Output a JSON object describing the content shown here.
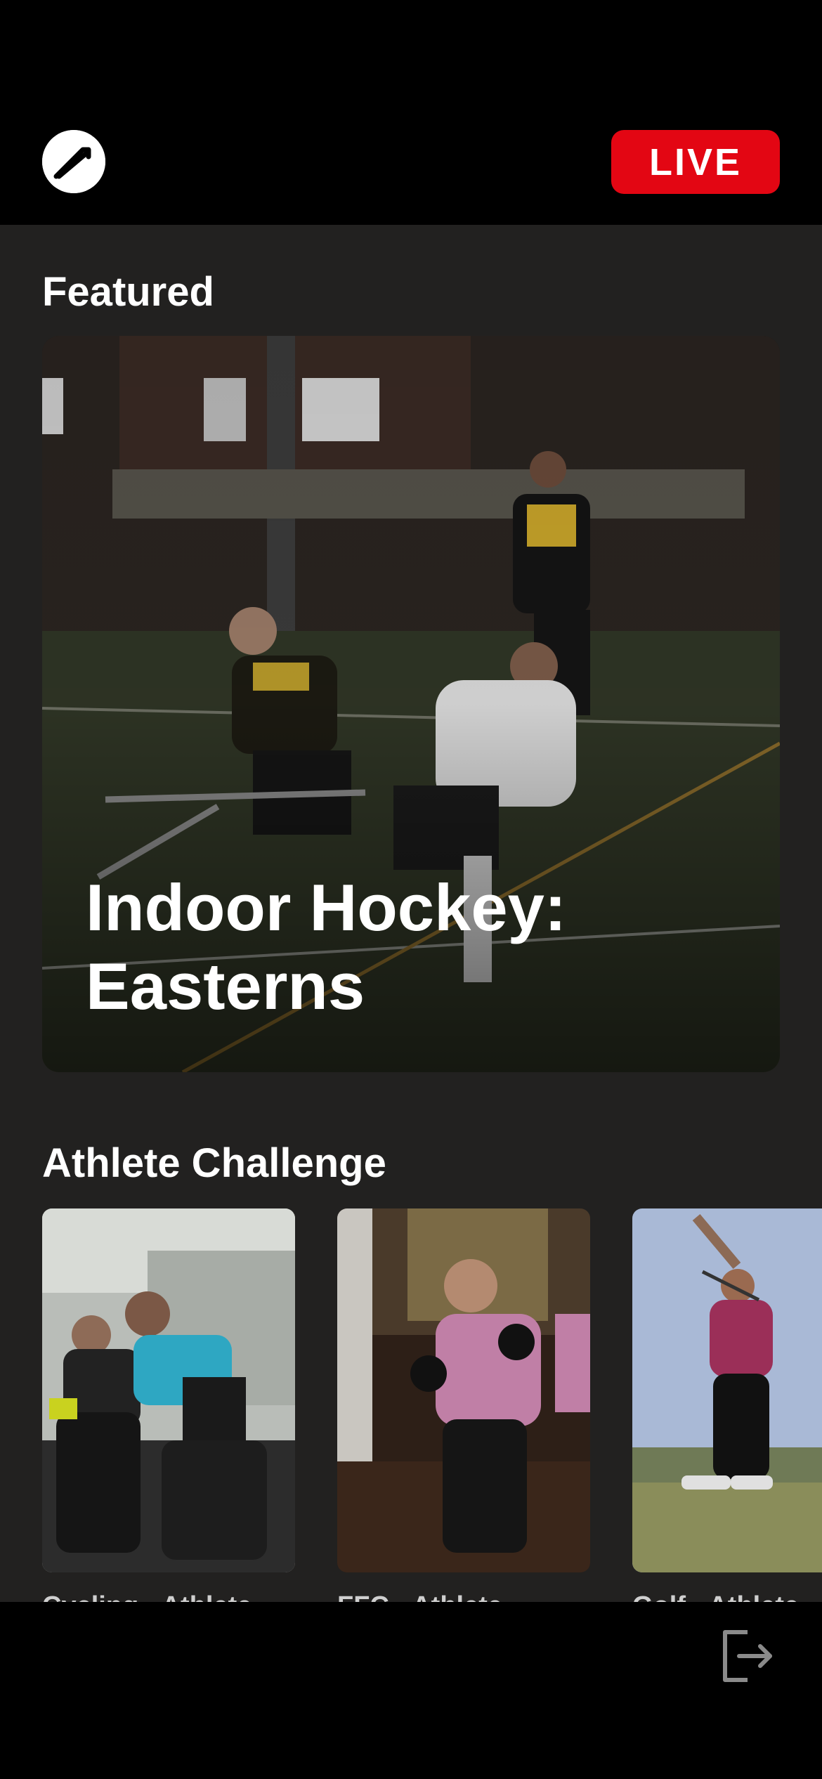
{
  "header": {
    "logo_icon": "brand-logo-icon",
    "live_label": "LIVE",
    "live_color": "#e30613"
  },
  "featured": {
    "section_title": "Featured",
    "card_title_line1": "Indoor Hockey:",
    "card_title_line2": "Easterns"
  },
  "athlete_challenge": {
    "section_title": "Athlete Challenge",
    "cards": [
      {
        "label": "Cycling - Athlete"
      },
      {
        "label": "FFC - Athlete"
      },
      {
        "label": "Golf - Athlete"
      }
    ]
  },
  "footer": {
    "logout_icon": "logout-icon"
  }
}
